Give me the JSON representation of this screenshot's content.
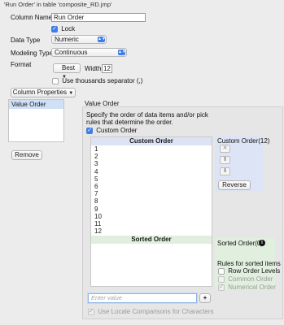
{
  "window": {
    "title": "'Run Order' in table 'composite_RD.jmp'"
  },
  "column": {
    "name_label": "Column Name",
    "name_value": "Run Order",
    "lock_label": "Lock",
    "data_type_label": "Data Type",
    "data_type_value": "Numeric",
    "modeling_type_label": "Modeling Type",
    "modeling_type_value": "Continuous",
    "format_label": "Format",
    "format_value": "Best",
    "width_label": "Width",
    "width_value": "12",
    "thousands_label": "Use thousands separator (,)"
  },
  "properties": {
    "menu_label": "Column Properties",
    "items": [
      "Value Order"
    ],
    "remove_label": "Remove"
  },
  "value_order": {
    "section_title": "Value Order",
    "description": "Specify the order of data items and/or pick rules that determine the order.",
    "custom_order_label": "Custom Order",
    "custom_header": "Custom Order",
    "custom_items": [
      "1",
      "2",
      "3",
      "4",
      "5",
      "6",
      "7",
      "8",
      "9",
      "10",
      "11",
      "12"
    ],
    "custom_count_label": "Custom Order(12)",
    "reverse_label": "Reverse",
    "sorted_header": "Sorted Order",
    "sorted_count_label": "Sorted Order(0)",
    "rules_label": "Rules for sorted items",
    "rules": [
      "Row Order Levels",
      "Common Order",
      "Numerical Order"
    ],
    "enter_placeholder": "Enter value",
    "add_label": "+",
    "locale_label": "Use Locale Comparisons for Characters"
  }
}
